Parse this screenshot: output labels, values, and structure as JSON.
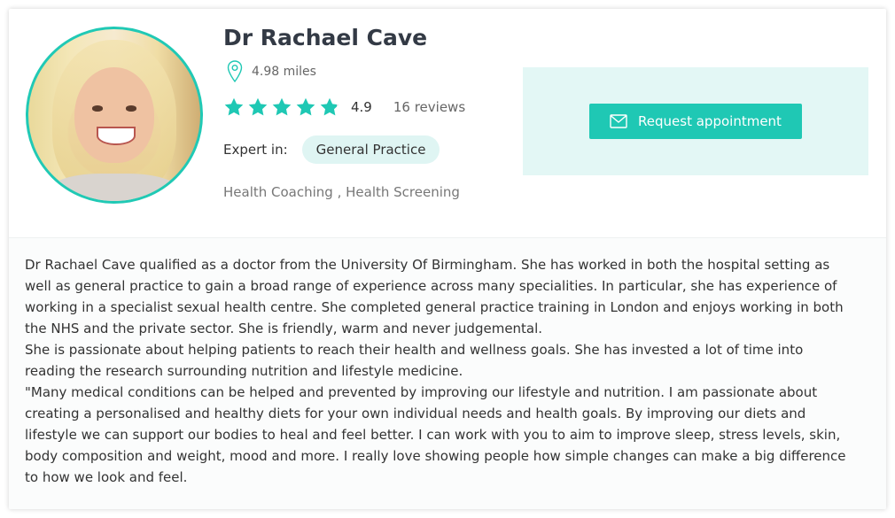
{
  "doctor": {
    "name": "Dr Rachael Cave",
    "distance": "4.98 miles",
    "rating": 4.9,
    "rating_label": "4.9",
    "reviews": "16 reviews",
    "expert_label": "Expert in:",
    "specialty": "General Practice",
    "tags": "Health Coaching , Health Screening"
  },
  "cta": {
    "label": "Request appointment"
  },
  "bio": {
    "paragraphs": [
      "Dr Rachael Cave qualified as a doctor from the University Of Birmingham. She has worked in both the hospital setting as well as general practice to gain a broad range of experience across many specialities. In particular, she has experience of working in a specialist sexual health centre. She completed general practice training in London and enjoys working in both the NHS and the private sector. She is friendly, warm and never judgemental.",
      "She is passionate about helping patients to reach their health and wellness goals. She has invested a lot of time into reading the research surrounding nutrition and lifestyle medicine.",
      "\"Many medical conditions can be helped and prevented by improving our lifestyle and nutrition. I am passionate about creating a personalised and healthy diets for your own individual needs and health goals. By improving our diets and lifestyle we can support our bodies to heal and feel better. I can work with you to aim to improve sleep, stress levels, skin, body composition and weight, mood and more. I really love showing people how simple changes can make a big difference to how we look and feel."
    ]
  },
  "colors": {
    "accent": "#1fc8b4",
    "accent_light": "#e3f7f5",
    "chip_bg": "#dff5f3",
    "star_empty": "#d8dcdc"
  },
  "icons": {
    "location": "map-pin-icon",
    "star": "star-icon",
    "mail": "envelope-icon"
  }
}
